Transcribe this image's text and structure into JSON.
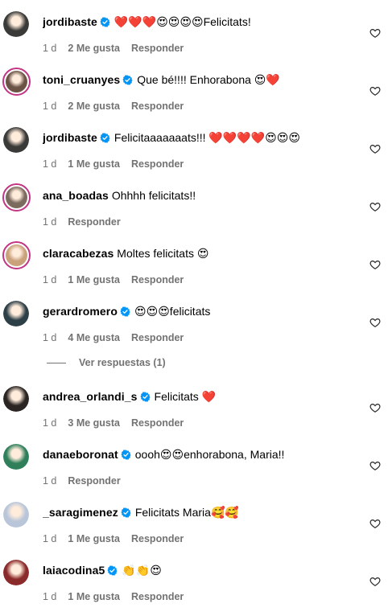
{
  "comments": [
    {
      "username": "jordibaste",
      "verified": true,
      "text": "❤️❤️❤️😍😍😍😍Felicitats!",
      "time": "1 d",
      "likes": "2 Me gusta",
      "reply": "Responder",
      "avatar_color": "#3a3a38",
      "ring": false
    },
    {
      "username": "toni_cruanyes",
      "verified": true,
      "text": "Que bé!!!! Enhorabona 😍❤️",
      "time": "1 d",
      "likes": "2 Me gusta",
      "reply": "Responder",
      "avatar_color": "#6b5446",
      "ring": true
    },
    {
      "username": "jordibaste",
      "verified": true,
      "text": "Felicitaaaaaaats!!! ❤️❤️❤️❤️😍😍😍",
      "time": "1 d",
      "likes": "1 Me gusta",
      "reply": "Responder",
      "avatar_color": "#3a3a38",
      "ring": false
    },
    {
      "username": "ana_boadas",
      "verified": false,
      "text": "Ohhhh felicitats!!",
      "time": "1 d",
      "likes": "",
      "reply": "Responder",
      "avatar_color": "#7b6a5e",
      "ring": true
    },
    {
      "username": "claracabezas",
      "verified": false,
      "text": "Moltes felicitats 😍",
      "time": "1 d",
      "likes": "1 Me gusta",
      "reply": "Responder",
      "avatar_color": "#c9a27c",
      "ring": true
    },
    {
      "username": "gerardromero",
      "verified": true,
      "text": "😍😍😍felicitats",
      "time": "1 d",
      "likes": "4 Me gusta",
      "reply": "Responder",
      "avatar_color": "#2d3f47",
      "ring": false
    },
    {
      "username": "andrea_orlandi_s",
      "verified": true,
      "text": "Felicitats ❤️",
      "time": "1 d",
      "likes": "3 Me gusta",
      "reply": "Responder",
      "avatar_color": "#2a2522",
      "ring": false
    },
    {
      "username": "danaeboronat",
      "verified": true,
      "text": "oooh😍😍enhorabona, Maria!!",
      "time": "1 d",
      "likes": "",
      "reply": "Responder",
      "avatar_color": "#2e7f5a",
      "ring": false
    },
    {
      "username": "_saragimenez",
      "verified": true,
      "text": "Felicitats Maria🥰🥰",
      "time": "1 d",
      "likes": "1 Me gusta",
      "reply": "Responder",
      "avatar_color": "#b9c6d9",
      "ring": false
    },
    {
      "username": "laiacodina5",
      "verified": true,
      "text": "👏👏😍",
      "time": "1 d",
      "likes": "1 Me gusta",
      "reply": "Responder",
      "avatar_color": "#8b2a2a",
      "ring": false
    }
  ],
  "view_replies": "Ver respuestas (1)",
  "icons": {
    "verified": "verified-badge-icon",
    "like": "heart-outline-icon"
  },
  "colors": {
    "verified": "#0095f6",
    "muted": "#737373",
    "ring": "#c13584"
  }
}
